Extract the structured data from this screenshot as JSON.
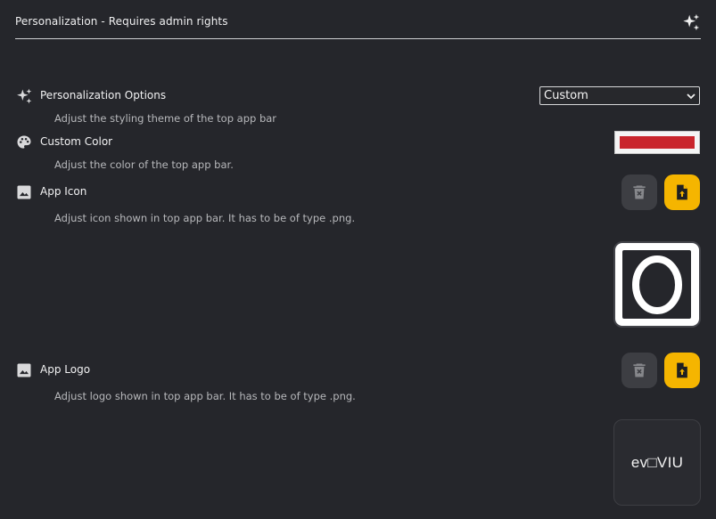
{
  "header": {
    "title": "Personalization - Requires admin rights",
    "icon": "sparkles-icon"
  },
  "options": {
    "title": "Personalization Options",
    "description": "Adjust the styling theme of the top app bar",
    "icon": "sparkles-icon",
    "selected_value": "Custom"
  },
  "custom_color": {
    "title": "Custom Color",
    "description": "Adjust the color of the top app bar.",
    "icon": "palette-icon",
    "value": "#c9252c"
  },
  "app_icon": {
    "title": "App Icon",
    "description": "Adjust icon shown in top app bar. It has to be of type .png.",
    "icon": "image-icon"
  },
  "app_logo": {
    "title": "App Logo",
    "description": "Adjust logo shown in top app bar. It has to be of type .png.",
    "icon": "image-icon",
    "preview_text": "ev□VIU"
  },
  "colors": {
    "background": "#25262b",
    "accent": "#f5b500",
    "delete_button": "#3d3e43"
  }
}
